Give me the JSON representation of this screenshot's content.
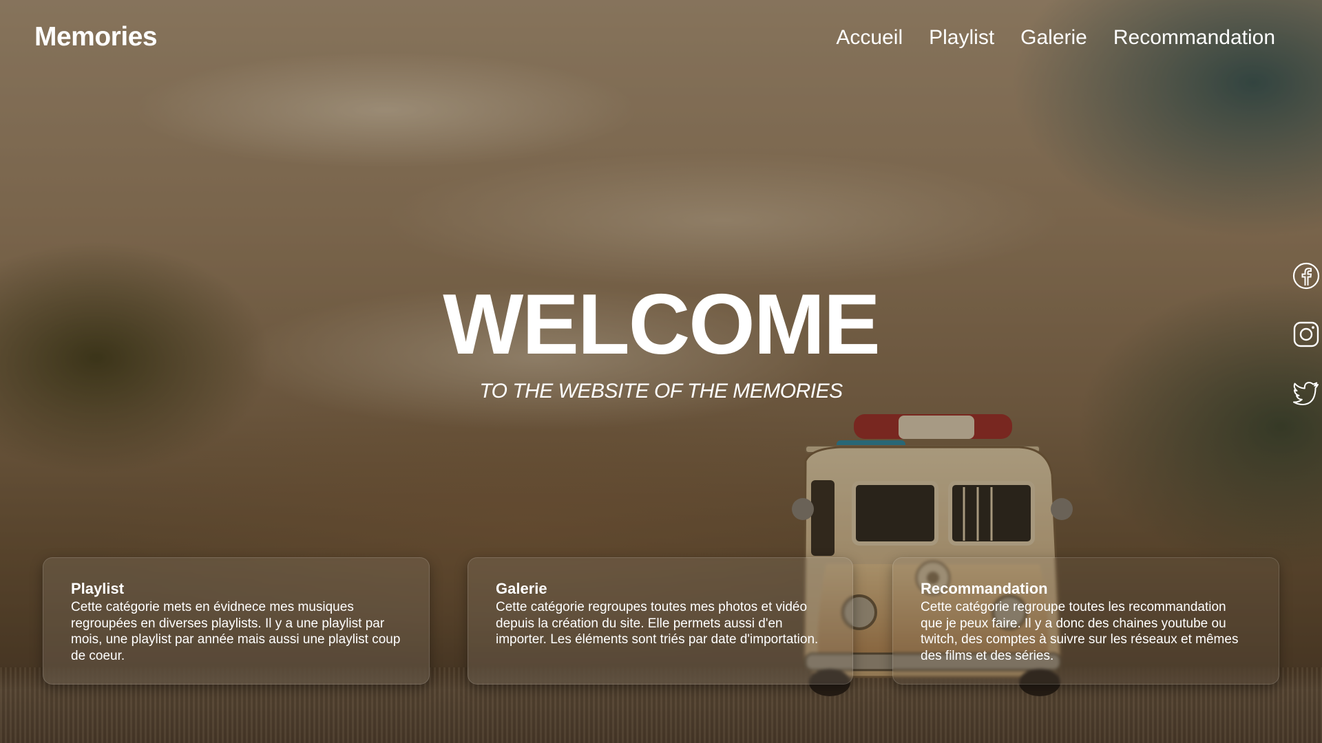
{
  "header": {
    "logo": "Memories",
    "nav": [
      "Accueil",
      "Playlist",
      "Galerie",
      "Recommandation"
    ]
  },
  "hero": {
    "title": "WELCOME",
    "subtitle": "TO THE WEBSITE OF THE MEMORIES"
  },
  "social": [
    "facebook-icon",
    "instagram-icon",
    "twitter-icon"
  ],
  "cards": [
    {
      "title": "Playlist",
      "text": "Cette catégorie mets en évidnece mes musiques regroupées en diverses playlists. Il y a une playlist par mois, une playlist par année mais aussi une playlist coup de coeur."
    },
    {
      "title": "Galerie",
      "text": "Cette catégorie regroupes toutes mes photos et vidéo depuis la création du site. Elle permets aussi d'en importer. Les éléments sont triés par date d'importation."
    },
    {
      "title": "Recommandation",
      "text": "Cette catégorie regroupe toutes les recommandation que je peux faire. Il y a donc des chaines youtube ou twitch, des comptes à suivre sur les réseaux et mêmes des films et des séries."
    }
  ]
}
